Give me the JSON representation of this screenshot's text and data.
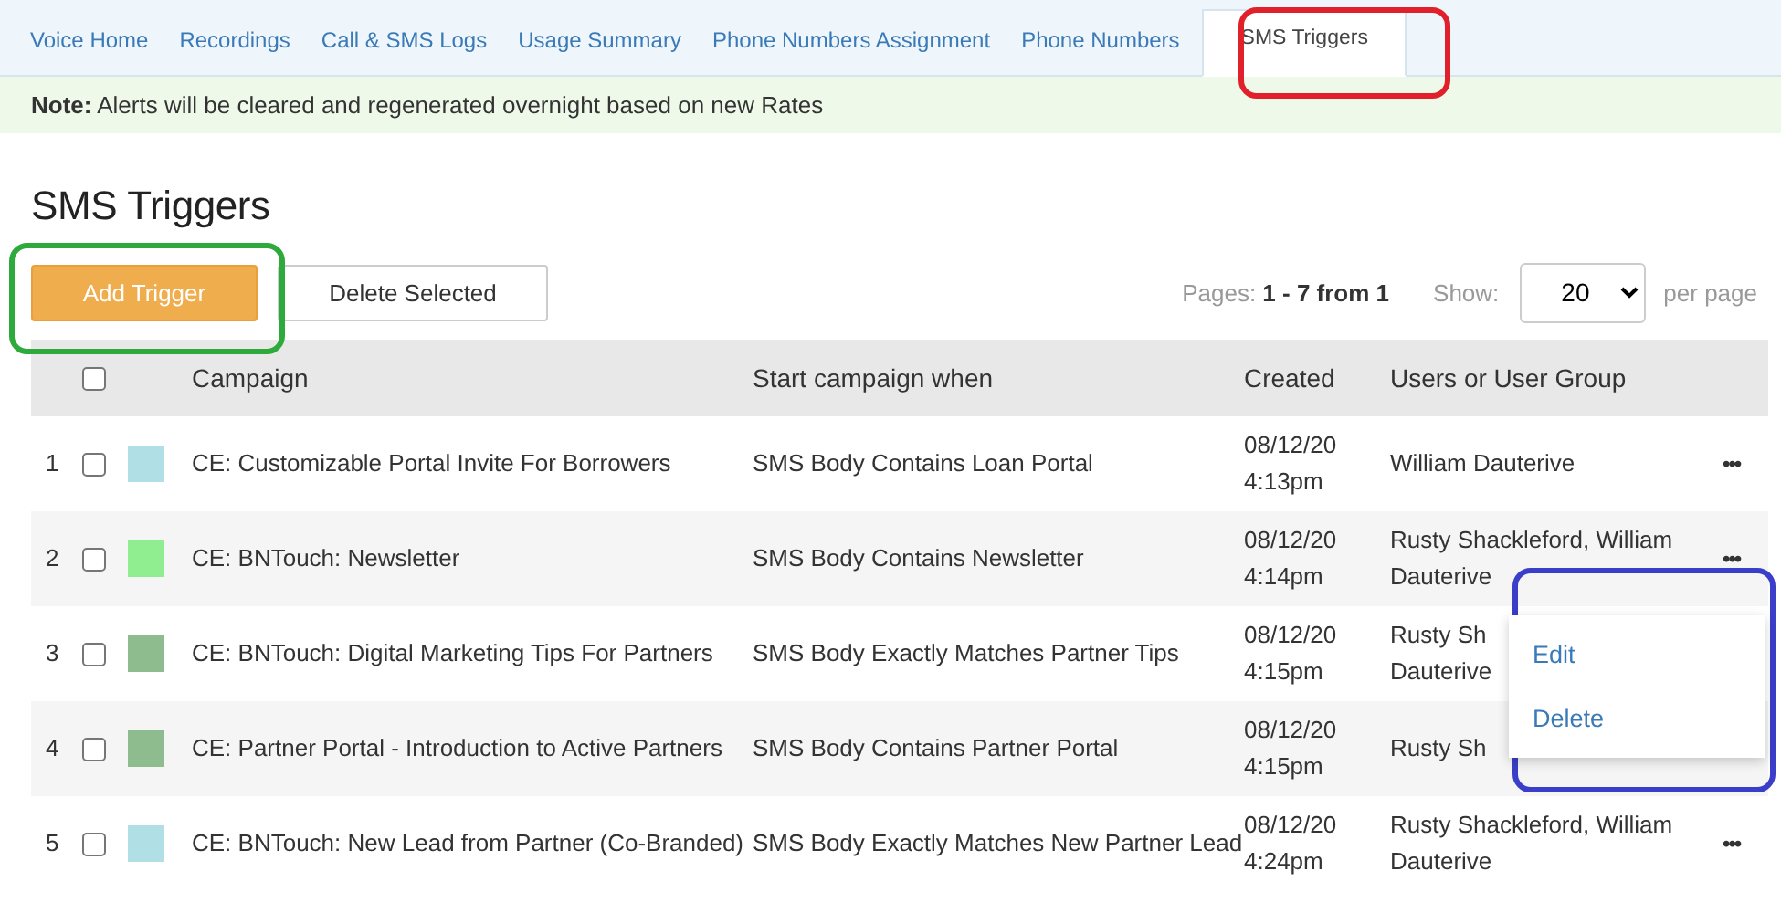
{
  "tabs": [
    {
      "label": "Voice Home",
      "selected": false
    },
    {
      "label": "Recordings",
      "selected": false
    },
    {
      "label": "Call & SMS Logs",
      "selected": false
    },
    {
      "label": "Usage Summary",
      "selected": false
    },
    {
      "label": "Phone Numbers Assignment",
      "selected": false
    },
    {
      "label": "Phone Numbers",
      "selected": false
    },
    {
      "label": "SMS Triggers",
      "selected": true
    }
  ],
  "note": "**Note:** Alerts will be cleared and regenerated overnight based on new Rates",
  "title": "SMS Triggers",
  "buttons": [
    {
      "label": "Add Trigger",
      "kind": "primary"
    },
    {
      "label": "Delete Selected",
      "kind": "secondary"
    }
  ],
  "pages": "Pages: **1 - 7 from 1**",
  "show_label": "Show:",
  "per_page": "20",
  "per_page_label": "per page",
  "table": {
    "select_all_checked": false,
    "columns": [
      "Campaign",
      "Start campaign when",
      "Created",
      "Users or User Group"
    ],
    "rows": [
      {
        "num": "1",
        "checked": false,
        "color": "#b0dfe5",
        "campaign": "CE: Customizable Portal Invite For Borrowers",
        "start": "SMS Body Contains Loan Portal",
        "created": "08/12/20\n4:13pm",
        "users": "William Dauterive",
        "actions": "•••"
      },
      {
        "num": "2",
        "checked": false,
        "color": "#90ee90",
        "campaign": "CE: BNTouch: Newsletter",
        "start": "SMS Body Contains Newsletter",
        "created": "08/12/20\n4:14pm",
        "users": "Rusty Shackleford, William\nDauterive",
        "actions": "•••"
      },
      {
        "num": "3",
        "checked": false,
        "color": "#8fbc8f",
        "campaign": "CE: BNTouch: Digital Marketing Tips For Partners",
        "start": "SMS Body Exactly Matches Partner Tips",
        "created": "08/12/20\n4:15pm",
        "users": "Rusty Sh\nDauterive"
      },
      {
        "num": "4",
        "checked": false,
        "color": "#8fbc8f",
        "campaign": "CE: Partner Portal - Introduction to Active Partners",
        "start": "SMS Body Contains Partner Portal",
        "created": "08/12/20\n4:15pm",
        "users": "Rusty Sh"
      },
      {
        "num": "5",
        "checked": false,
        "color": "#b0e0e6",
        "campaign": "CE: BNTouch: New Lead from Partner (Co-Branded)",
        "start": "SMS Body Exactly Matches New Partner Lead",
        "created": "08/12/20\n4:24pm",
        "users": "Rusty Shackleford, William\nDauterive",
        "actions": "•••"
      }
    ]
  },
  "menu": [
    "Edit",
    "Delete"
  ],
  "annotations": [
    {
      "color": "#e0202a"
    },
    {
      "color": "#2eaa3c"
    },
    {
      "color": "#3a3ec8"
    }
  ]
}
